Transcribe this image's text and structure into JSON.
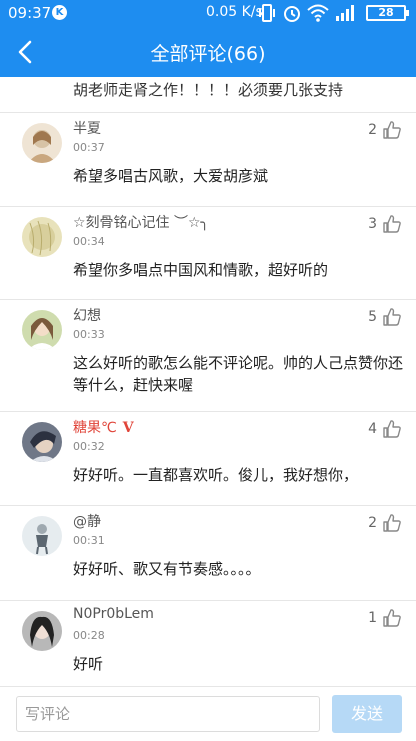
{
  "status_bar": {
    "time": "09:37",
    "app_badge": "K",
    "net_speed": "0.05 K/s",
    "battery": "28"
  },
  "header": {
    "title": "全部评论(66)"
  },
  "top_snippet": "胡老师走肾之作！！！！必须要几张支持",
  "comments": [
    {
      "name": "半夏",
      "time": "00:37",
      "likes": "2",
      "text": "希望多唱古风歌，大爱胡彦斌",
      "avatar_color": "#d7c3a6"
    },
    {
      "name": "☆刻骨铭心记住 ︶☆╮",
      "time": "00:34",
      "likes": "3",
      "text": "希望你多唱点中国风和情歌，超好听的",
      "avatar_color": "#d8cf9c"
    },
    {
      "name": "幻想",
      "time": "00:33",
      "likes": "5",
      "text": "这么好听的歌怎么能不评论呢。帅的人己点赞你还等什么，赶快来喔",
      "avatar_color": "#b9c79a"
    },
    {
      "name": "糖果℃",
      "vip_badge": "V",
      "time": "00:32",
      "likes": "4",
      "text": "好好听。一直都喜欢听。俊儿，我好想你，",
      "avatar_color": "#4a5263"
    },
    {
      "name": "@静",
      "time": "00:31",
      "likes": "2",
      "text": "好好听、歌又有节奏感。。。。",
      "avatar_color": "#c8d0d6"
    },
    {
      "name": "N0Pr0bLem",
      "time": "00:28",
      "likes": "1",
      "text": "好听",
      "avatar_color": "#8a8a8a"
    }
  ],
  "composer": {
    "placeholder": "写评论",
    "send_label": "发送"
  }
}
